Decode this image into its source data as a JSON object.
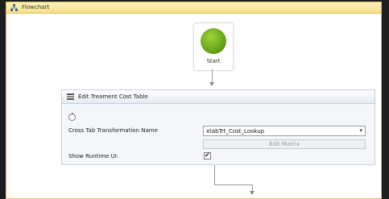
{
  "window": {
    "title": "Flowchart"
  },
  "start_node": {
    "label": "Start"
  },
  "activity": {
    "title": "Edit Treament Cost Table",
    "fields": {
      "crosstab_label": "Cross Tab Transformation Name",
      "crosstab_value": "xtabTrt_Cost_Lookup",
      "edit_matrix_label": "Edit Matrix",
      "runtime_ui_label": "Show Runtime UI:",
      "runtime_ui_checked": true
    }
  },
  "colors": {
    "titlebar": "#f5de86",
    "start_green": "#6aa81c",
    "activity_border": "#c9cfdb"
  },
  "icons": {
    "titlebar": "flowchart-icon",
    "activity": "activity-icon",
    "collapse": "collapse-icon",
    "dropdown": "chevron-down-icon",
    "check": "checkmark-icon"
  }
}
